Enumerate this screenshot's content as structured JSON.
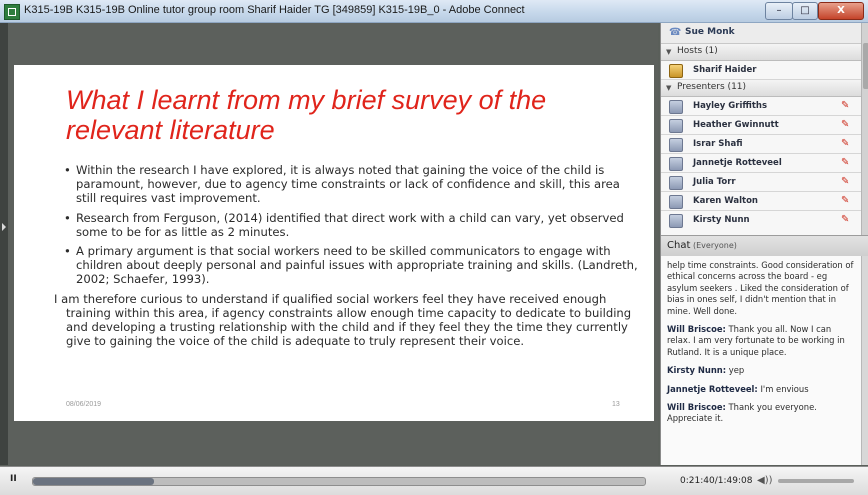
{
  "window": {
    "title": "K315-19B K315-19B Online tutor group room Sharif Haider TG [349859] K315-19B_0 - Adobe Connect",
    "minimize": "–",
    "maximize": "□",
    "close": "X"
  },
  "slide": {
    "title": "What I learnt from my brief survey of the relevant literature",
    "bullets": [
      "Within the research I have explored, it is always noted that gaining the voice of the child is paramount, however, due to agency time constraints or lack of confidence and skill, this area still requires vast improvement.",
      "Research from Ferguson, (2014) identified that direct work with a child can vary, yet observed some to be for as little as 2 minutes.",
      "A primary argument is that social workers need to be skilled communicators to engage with children about deeply personal and painful issues with appropriate training and skills. (Landreth, 2002; Schaefer, 1993)."
    ],
    "paragraph": "I am therefore curious to understand if qualified social workers feel they have received enough training within this area, if agency constraints allow enough time capacity to dedicate to building and developing a trusting relationship with the child and if they feel they the time they currently give to gaining the voice of the child is adequate to truly represent their voice.",
    "footer_date": "08/06/2019",
    "page_number": "13"
  },
  "attendees": {
    "current_user": "Sue Monk",
    "hosts_header": "Hosts (1)",
    "hosts": [
      "Sharif Haider"
    ],
    "presenters_header": "Presenters (11)",
    "presenters": [
      "Hayley Griffiths",
      "Heather Gwinnutt",
      "Israr Shafi",
      "Jannetje Rotteveel",
      "Julia Torr",
      "Karen Walton",
      "Kirsty Nunn"
    ]
  },
  "chat": {
    "title": "Chat",
    "scope": "(Everyone)",
    "messages": [
      {
        "sender": "",
        "text": "help time constraints. Good consideration of ethical concerns across the board - eg asylum seekers . Liked the consideration of bias in ones self, I didn't mention that in mine. Well done."
      },
      {
        "sender": "Will Briscoe:",
        "text": " Thank you all. Now I can relax. I am very fortunate to be working in Rutland. It is a unique place."
      },
      {
        "sender": "Kirsty Nunn:",
        "text": " yep"
      },
      {
        "sender": "Jannetje Rotteveel:",
        "text": " I'm envious"
      },
      {
        "sender": "Will Briscoe:",
        "text": " Thank you everyone. Appreciate it."
      }
    ]
  },
  "playback": {
    "pause_label": "II",
    "time": "0:21:40/1:49:08",
    "progress_fraction": 0.198
  },
  "colors": {
    "slide_title": "#e0241b",
    "mic_muted": "#cc2a1a",
    "stage_bg": "#5c605c"
  },
  "icons": {
    "user": "user-icon",
    "host": "host-icon",
    "presenter": "presenter-icon",
    "mic_off": "mic-muted-icon",
    "volume": "volume-icon"
  }
}
